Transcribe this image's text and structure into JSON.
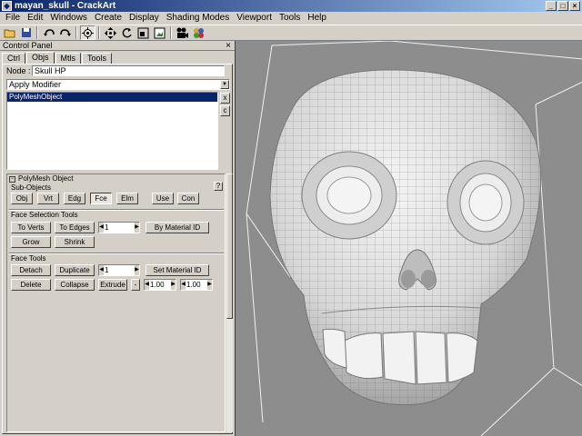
{
  "window": {
    "title": "mayan_skull - CrackArt",
    "minimize": "_",
    "maximize": "□",
    "close": "×"
  },
  "menus": [
    "File",
    "Edit",
    "Windows",
    "Create",
    "Display",
    "Shading Modes",
    "Viewport",
    "Tools",
    "Help"
  ],
  "toolbar_icons": [
    "open-icon",
    "save-icon",
    "undo-icon",
    "redo-icon",
    "select-icon",
    "move-icon",
    "rotate-icon",
    "scale-icon",
    "render-icon",
    "camera-icon",
    "materials-icon"
  ],
  "panel": {
    "title": "Control Panel",
    "close": "×",
    "tabs": [
      "Ctrl",
      "Objs",
      "Mtls",
      "Tools"
    ],
    "active_tab": "Objs",
    "node_label": "Node :",
    "node_value": "Skull HP",
    "modifier": "Apply Modifier",
    "stack_items": [
      "PolyMeshObject"
    ],
    "side_buttons": [
      "x",
      "c"
    ],
    "rollout_title": "PolyMesh Object",
    "help": "?",
    "subobjects": {
      "label": "Sub-Objects",
      "buttons": [
        "Obj",
        "Vrt",
        "Edg",
        "Fce",
        "Elm",
        "Use",
        "Con"
      ],
      "active": "Fce"
    },
    "face_selection": {
      "label": "Face Selection Tools",
      "to_verts": "To Verts",
      "to_edges": "To Edges",
      "value": "1",
      "by_material": "By Material ID",
      "grow": "Grow",
      "shrink": "Shrink"
    },
    "face_tools": {
      "label": "Face Tools",
      "detach": "Detach",
      "duplicate": "Duplicate",
      "value": "1",
      "set_material": "Set Material ID",
      "delete": "Delete",
      "collapse": "Collapse",
      "extrude": "Extrude",
      "minus": "-",
      "extrude_a": "1.00",
      "extrude_b": "1.00"
    }
  }
}
